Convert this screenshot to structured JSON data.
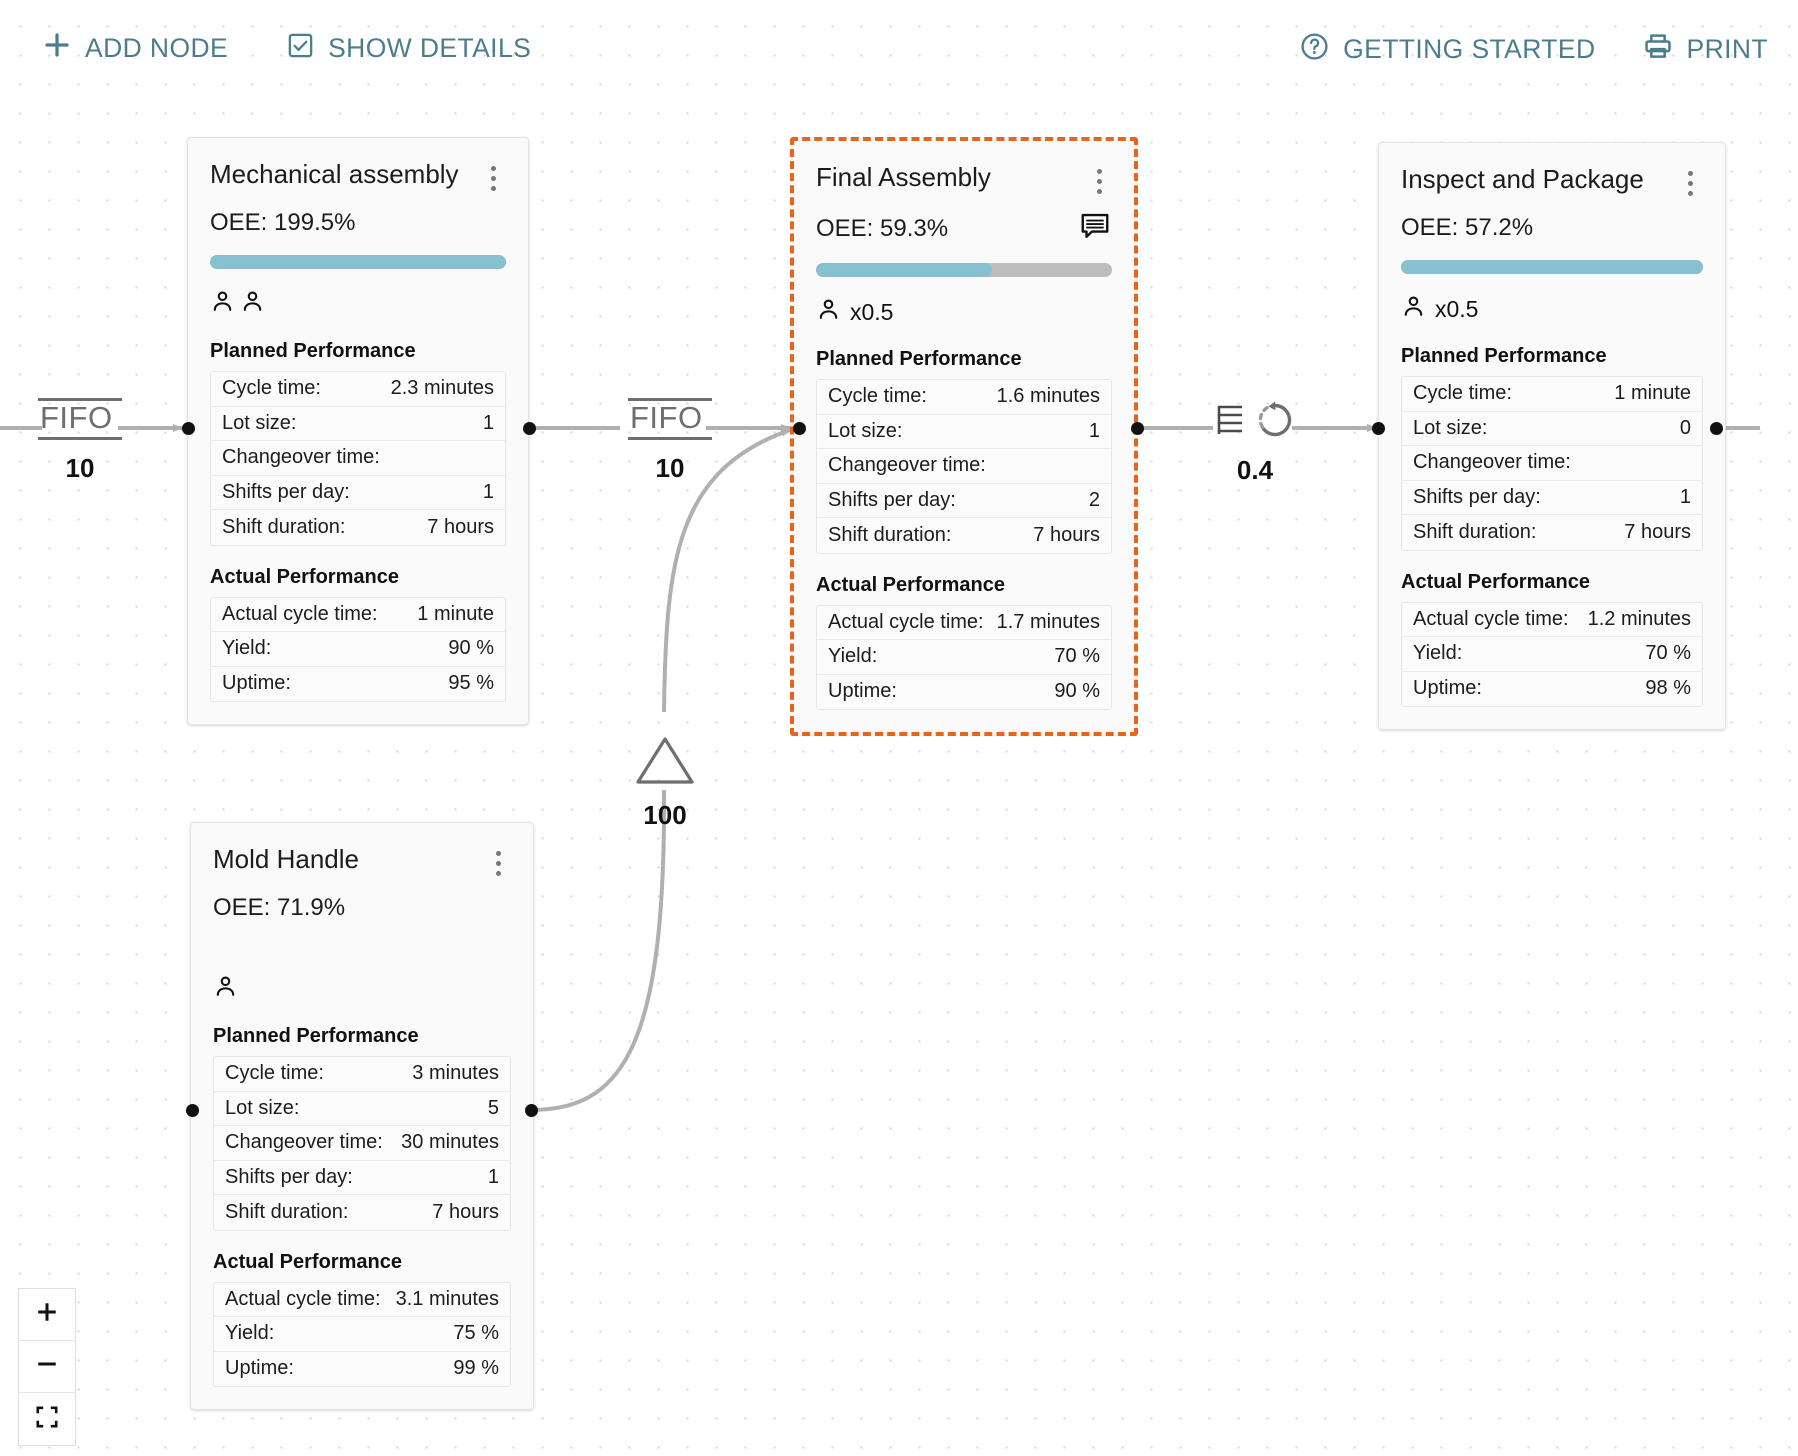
{
  "toolbar": {
    "left": [
      {
        "id": "add-node",
        "label": "ADD NODE",
        "icon": "plus-icon"
      },
      {
        "id": "show-details",
        "label": "SHOW DETAILS",
        "icon": "checkbox-checked-icon"
      }
    ],
    "right": [
      {
        "id": "getting-started",
        "label": "GETTING STARTED",
        "icon": "help-circle-icon"
      },
      {
        "id": "print",
        "label": "PRINT",
        "icon": "printer-icon"
      }
    ],
    "accent_color": "#4d7d8c"
  },
  "labels": {
    "planned_performance": "Planned Performance",
    "actual_performance": "Actual Performance",
    "cycle_time": "Cycle time:",
    "lot_size": "Lot size:",
    "changeover_time": "Changeover time:",
    "shifts_per_day": "Shifts per day:",
    "shift_duration": "Shift duration:",
    "actual_cycle_time": "Actual cycle time:",
    "yield": "Yield:",
    "uptime": "Uptime:"
  },
  "colors": {
    "progress_fill": "#86c0d1",
    "progress_track": "#bdbdbd",
    "selected_border": "#e8641a",
    "edge": "#b0b0b0",
    "symbol": "#6e6e6e"
  },
  "nodes": [
    {
      "id": "mechanical-assembly",
      "title": "Mechanical assembly",
      "oee": "OEE: 199.5%",
      "progress_percent": 100,
      "has_progress_bar": true,
      "operators_icon_count": 2,
      "operators_multiplier": "",
      "has_comment": false,
      "selected": false,
      "planned": [
        {
          "key": "Cycle time:",
          "value": "2.3 minutes"
        },
        {
          "key": "Lot size:",
          "value": "1"
        },
        {
          "key": "Changeover time:",
          "value": ""
        },
        {
          "key": "Shifts per day:",
          "value": "1"
        },
        {
          "key": "Shift duration:",
          "value": "7 hours"
        }
      ],
      "actual": [
        {
          "key": "Actual cycle time:",
          "value": "1 minute"
        },
        {
          "key": "Yield:",
          "value": "90 %"
        },
        {
          "key": "Uptime:",
          "value": "95 %"
        }
      ]
    },
    {
      "id": "final-assembly",
      "title": "Final Assembly",
      "oee": "OEE: 59.3%",
      "progress_percent": 59.3,
      "has_progress_bar": true,
      "operators_icon_count": 1,
      "operators_multiplier": "x0.5",
      "has_comment": true,
      "selected": true,
      "planned": [
        {
          "key": "Cycle time:",
          "value": "1.6 minutes"
        },
        {
          "key": "Lot size:",
          "value": "1"
        },
        {
          "key": "Changeover time:",
          "value": ""
        },
        {
          "key": "Shifts per day:",
          "value": "2"
        },
        {
          "key": "Shift duration:",
          "value": "7 hours"
        }
      ],
      "actual": [
        {
          "key": "Actual cycle time:",
          "value": "1.7 minutes"
        },
        {
          "key": "Yield:",
          "value": "70 %"
        },
        {
          "key": "Uptime:",
          "value": "90 %"
        }
      ]
    },
    {
      "id": "inspect-and-package",
      "title": "Inspect and Package",
      "oee": "OEE: 57.2%",
      "progress_percent": 100,
      "has_progress_bar": true,
      "operators_icon_count": 1,
      "operators_multiplier": "x0.5",
      "has_comment": false,
      "selected": false,
      "planned": [
        {
          "key": "Cycle time:",
          "value": "1 minute"
        },
        {
          "key": "Lot size:",
          "value": "0"
        },
        {
          "key": "Changeover time:",
          "value": ""
        },
        {
          "key": "Shifts per day:",
          "value": "1"
        },
        {
          "key": "Shift duration:",
          "value": "7 hours"
        }
      ],
      "actual": [
        {
          "key": "Actual cycle time:",
          "value": "1.2 minutes"
        },
        {
          "key": "Yield:",
          "value": "70 %"
        },
        {
          "key": "Uptime:",
          "value": "98 %"
        }
      ]
    },
    {
      "id": "mold-handle",
      "title": "Mold Handle",
      "oee": "OEE: 71.9%",
      "progress_percent": 0,
      "has_progress_bar": false,
      "operators_icon_count": 1,
      "operators_multiplier": "",
      "has_comment": false,
      "selected": false,
      "planned": [
        {
          "key": "Cycle time:",
          "value": "3 minutes"
        },
        {
          "key": "Lot size:",
          "value": "5"
        },
        {
          "key": "Changeover time:",
          "value": "30 minutes"
        },
        {
          "key": "Shifts per day:",
          "value": "1"
        },
        {
          "key": "Shift duration:",
          "value": "7 hours"
        }
      ],
      "actual": [
        {
          "key": "Actual cycle time:",
          "value": "3.1 minutes"
        },
        {
          "key": "Yield:",
          "value": "75 %"
        },
        {
          "key": "Uptime:",
          "value": "99 %"
        }
      ]
    }
  ],
  "connectors": [
    {
      "id": "fifo-inbound",
      "type": "fifo",
      "symbol_text": "FIFO",
      "count": "10"
    },
    {
      "id": "fifo-mech-to-final",
      "type": "fifo",
      "symbol_text": "FIFO",
      "count": "10"
    },
    {
      "id": "inventory-mold-to-final",
      "type": "inventory-triangle",
      "symbol_text": "",
      "count": "100"
    },
    {
      "id": "batch-rework-final-to-inspect",
      "type": "batch-rework",
      "symbol_text": "",
      "count": "0.4"
    }
  ],
  "zoom_controls": [
    {
      "id": "zoom-in",
      "icon": "plus-icon"
    },
    {
      "id": "zoom-out",
      "icon": "minus-icon"
    },
    {
      "id": "fit-view",
      "icon": "fit-screen-icon"
    }
  ]
}
